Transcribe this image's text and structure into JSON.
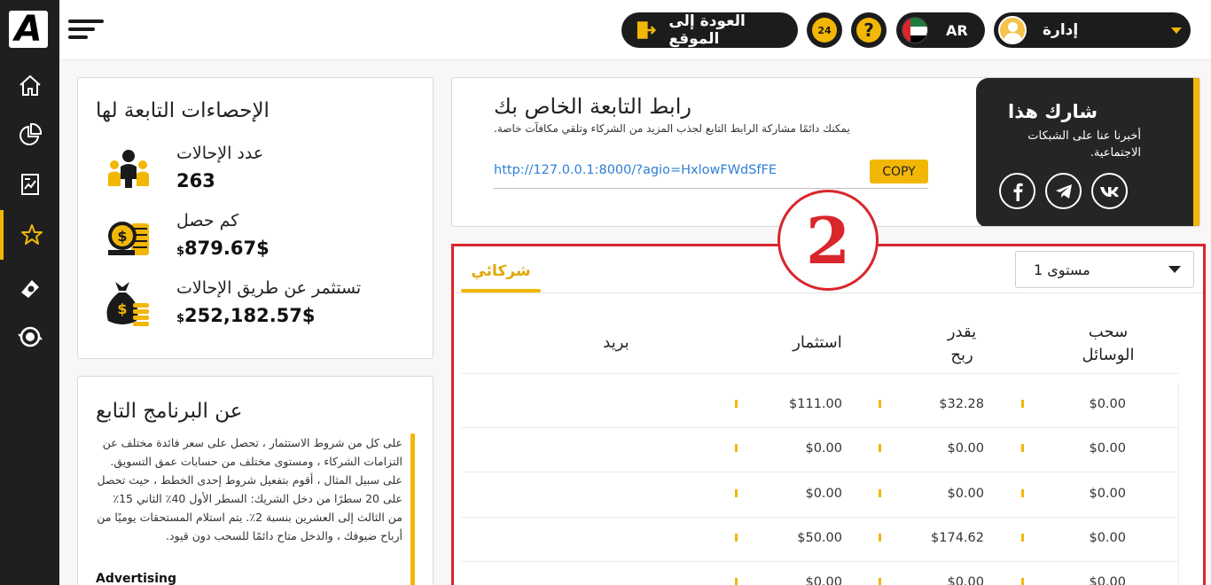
{
  "app": {
    "logo_letter": "A",
    "accent_color": "#f2b705",
    "frame_color": "#d9262b"
  },
  "sidebar": {
    "items": [
      {
        "icon": "home-icon"
      },
      {
        "icon": "pie-chart-icon"
      },
      {
        "icon": "report-icon"
      },
      {
        "icon": "star-icon",
        "active": true
      },
      {
        "icon": "cash-icon"
      },
      {
        "icon": "exchange-icon"
      }
    ]
  },
  "header": {
    "back_label": "العودة إلى الموقع",
    "support_badge": "24",
    "help_label": "?",
    "lang_label": "AR",
    "user_label": "إدارة"
  },
  "stats": {
    "title": "الإحصاءات التابعة لها",
    "rows": [
      {
        "label": "عدد الإحالات",
        "value": "263",
        "prefix": ""
      },
      {
        "label": "كم حصل",
        "value": "879.67$",
        "prefix": "$"
      },
      {
        "label": "تستثمر عن طريق الإحالات",
        "value": "252,182.57$",
        "prefix": "$"
      }
    ]
  },
  "about": {
    "title": "عن البرنامج التابع",
    "text": "على كل من شروط الاستثمار ، تحصل على سعر فائدة مختلف عن التزامات الشركاء ، ومستوى مختلف من حسابات عمق التسويق. على سبيل المثال ، أقوم بتفعيل شروط إحدى الخطط ، حيث تحصل على 20 سطرًا من دخل الشريك: السطر الأول 40٪ الثاني 15٪ من الثالث إلى العشرين بنسبة 2٪. يتم استلام المستحقات يوميًا من أرباح ضيوفك ، والدخل متاح دائمًا للسحب دون قيود.",
    "subheading": "Advertising"
  },
  "link": {
    "title": "رابط التابعة الخاص بك",
    "description": ".يمكنك دائمًا مشاركة الرابط التابع لجذب المزيد من الشركاء وتلقي مكافآت خاصة",
    "url": "http://127.0.0.1:8000/?agio=HxlowFWdSfFE",
    "copy_label": "COPY"
  },
  "share": {
    "title": "شارك هذا",
    "description": "أخبرنا عنا على الشبكات الاجتماعية.",
    "networks": [
      "facebook-icon",
      "telegram-icon",
      "vk-icon"
    ]
  },
  "referrals": {
    "badge_number": "2",
    "tab_label": "شركائي",
    "level_label": "مستوى 1",
    "columns": {
      "email": "بريد",
      "investment": "استثمار",
      "profit_line1": "يقدر",
      "profit_line2": "ربح",
      "withdraw_line1": "سحب",
      "withdraw_line2": "الوسائل"
    },
    "rows": [
      {
        "investment": "$111.00",
        "profit": "$32.28",
        "withdraw": "$0.00"
      },
      {
        "investment": "$0.00",
        "profit": "$0.00",
        "withdraw": "$0.00"
      },
      {
        "investment": "$0.00",
        "profit": "$0.00",
        "withdraw": "$0.00"
      },
      {
        "investment": "$50.00",
        "profit": "$174.62",
        "withdraw": "$0.00"
      },
      {
        "investment": "$0.00",
        "profit": "$0.00",
        "withdraw": "$0.00"
      }
    ]
  }
}
